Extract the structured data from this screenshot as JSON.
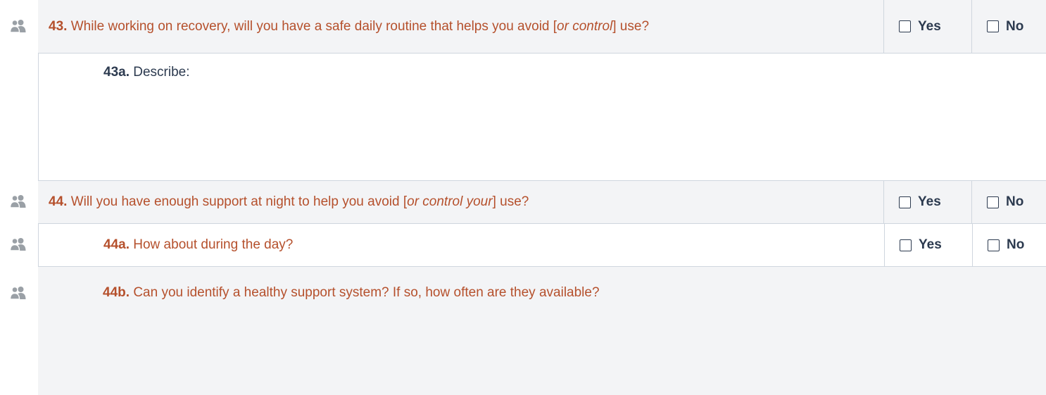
{
  "questions": {
    "q43": {
      "number": "43.",
      "text_before": "While working on recovery, will you have a safe daily routine that helps you avoid [",
      "text_italic": "or control",
      "text_after": "] use?",
      "yes": "Yes",
      "no": "No"
    },
    "q43a": {
      "number": "43a.",
      "text": "Describe:"
    },
    "q44": {
      "number": "44.",
      "text_before": "Will you have enough support at night to help you avoid [",
      "text_italic": "or control your",
      "text_after": "] use?",
      "yes": "Yes",
      "no": "No"
    },
    "q44a": {
      "number": "44a.",
      "text": "How about during the day?",
      "yes": "Yes",
      "no": "No"
    },
    "q44b": {
      "number": "44b.",
      "text": "Can you identify a healthy support system? If so, how often are they available?"
    }
  },
  "icons": {
    "interviewer": "people-icon"
  },
  "colors": {
    "question_text": "#b5502c",
    "body_text": "#2c3a4f",
    "shaded_bg": "#f3f4f6",
    "border": "#cfd6de",
    "icon": "#9aa0a6"
  }
}
